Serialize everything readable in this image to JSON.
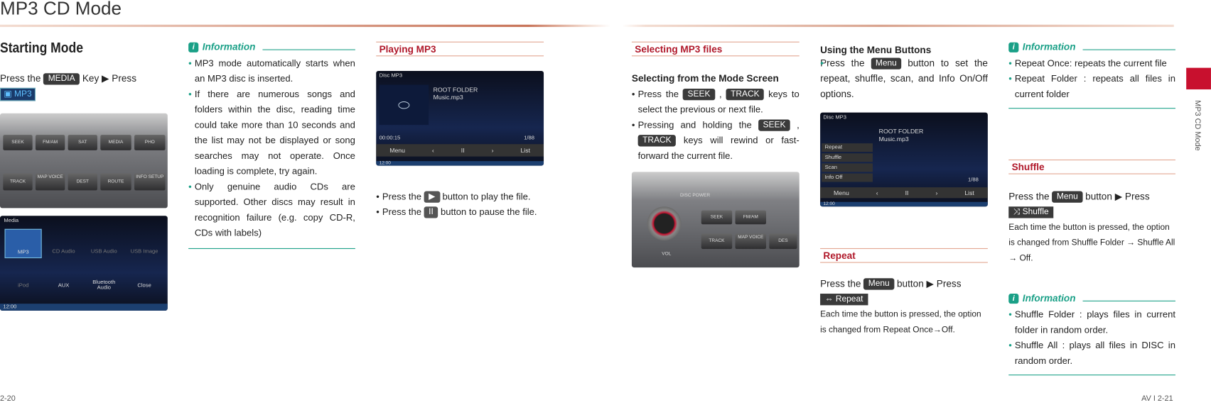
{
  "header": {
    "title": "MP3 CD Mode"
  },
  "starting": {
    "title": "Starting Mode",
    "press_the": "Press the",
    "media_key": "MEDIA",
    "key_press": "Key ▶ Press",
    "mp3_button": "MP3"
  },
  "panel1": {
    "keys": [
      "SEEK",
      "FM/AM",
      "SAT",
      "MEDIA",
      "PHO",
      "TRACK",
      "MAP VOICE",
      "DEST",
      "ROUTE",
      "INFO SETUP"
    ]
  },
  "media_screen": {
    "title": "Media",
    "items": [
      "MP3",
      "CD Audio",
      "USB Audio",
      "USB Image",
      "iPod",
      "AUX",
      "Bluetooth Audio",
      "Close"
    ],
    "clock": "12:00"
  },
  "info1": {
    "title": "Information",
    "bullets": [
      "MP3 mode automatically starts when an MP3 disc is inserted.",
      "If there are numerous songs and folders within the disc, reading time could take more than 10 seconds and the list may not be displayed or song searches may not operate. Once loading is complete, try again.",
      "Only genuine audio CDs are supported. Other discs may result in recognition failure (e.g. copy CD-R, CDs with labels)"
    ]
  },
  "playing": {
    "title": "Playing MP3",
    "bullets": [
      {
        "pre": "Press the",
        "btn": "▶",
        "post": "button to play the file."
      },
      {
        "pre": "Press the",
        "btn": "II",
        "post": "button to pause the file."
      }
    ]
  },
  "mp3_screen": {
    "header": "Disc  MP3",
    "folder": "ROOT FOLDER",
    "file": "Music.mp3",
    "time": "00:00:15",
    "track": "1/88",
    "menu": "Menu",
    "list": "List",
    "clock": "12:00"
  },
  "selecting": {
    "title": "Selecting MP3 files",
    "subtitle": "Selecting from the Mode Screen",
    "b1_pre": "Press the",
    "seek": "SEEK",
    "track": "TRACK",
    "b1_post": "keys to select the previous or next file.",
    "b2_pre": "Pressing and holding the",
    "b2_post": "keys will rewind or fast-forward the current file."
  },
  "panel2": {
    "keys": [
      "DISC POWER",
      "SEEK",
      "FM/AM",
      "TRACK",
      "MAP VOICE",
      "DES",
      "VOL"
    ]
  },
  "menu_buttons": {
    "title": "Using the Menu Buttons",
    "pre": "Press the",
    "menu": "Menu",
    "post": "button to set the repeat, shuffle, scan, and Info On/Off options."
  },
  "menu_screen": {
    "items": [
      "Repeat",
      "Shuffle",
      "Scan",
      "Info Off"
    ]
  },
  "repeat": {
    "title": "Repeat",
    "pre": "Press the",
    "menu": "Menu",
    "mid": "button ▶ Press",
    "button": "Repeat",
    "desc": "Each time the button is pressed, the option is changed from Repeat Once→Off."
  },
  "info2": {
    "title": "Information",
    "bullets": [
      "Repeat Once: repeats the current file",
      "Repeat Folder : repeats all files in current folder"
    ]
  },
  "shuffle": {
    "title": "Shuffle",
    "pre": "Press the",
    "menu": "Menu",
    "mid": "button ▶ Press",
    "button": "Shuffle",
    "desc": "Each time the button is pressed, the option is changed from Shuffle Folder → Shuffle All → Off."
  },
  "info3": {
    "title": "Information",
    "bullets": [
      "Shuffle Folder : plays files in current folder in random order.",
      "Shuffle All : plays all files in DISC in random order."
    ]
  },
  "side_tab": {
    "label": "MP3 CD Mode",
    "color": "#c8102e"
  },
  "footer": {
    "left": "2-20",
    "right": "AV I 2-21"
  }
}
